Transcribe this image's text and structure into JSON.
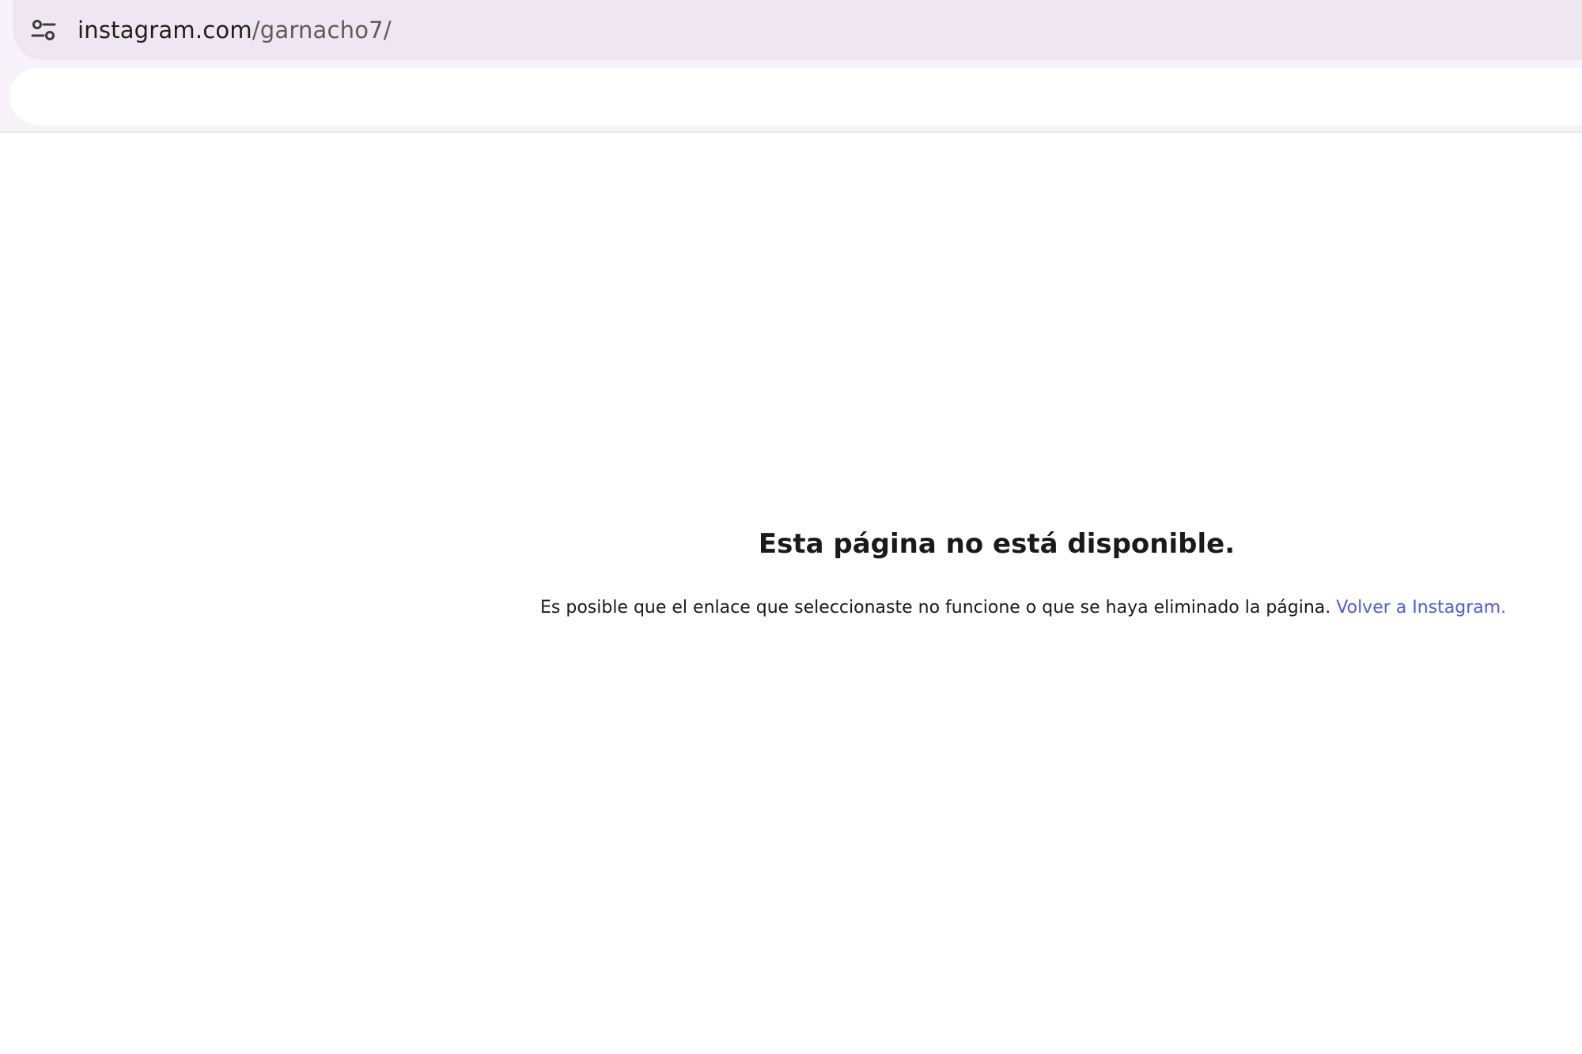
{
  "browser": {
    "address_bar": {
      "host": "instagram.com",
      "path": "/garnacho7/"
    },
    "site_settings_icon": "tune-icon"
  },
  "page": {
    "error_title": "Esta página no está disponible.",
    "error_message": "Es posible que el enlace que seleccionaste no funcione o que se haya eliminado la página.",
    "back_link": "Volver a Instagram.",
    "link_color": "#4a5cf0"
  }
}
